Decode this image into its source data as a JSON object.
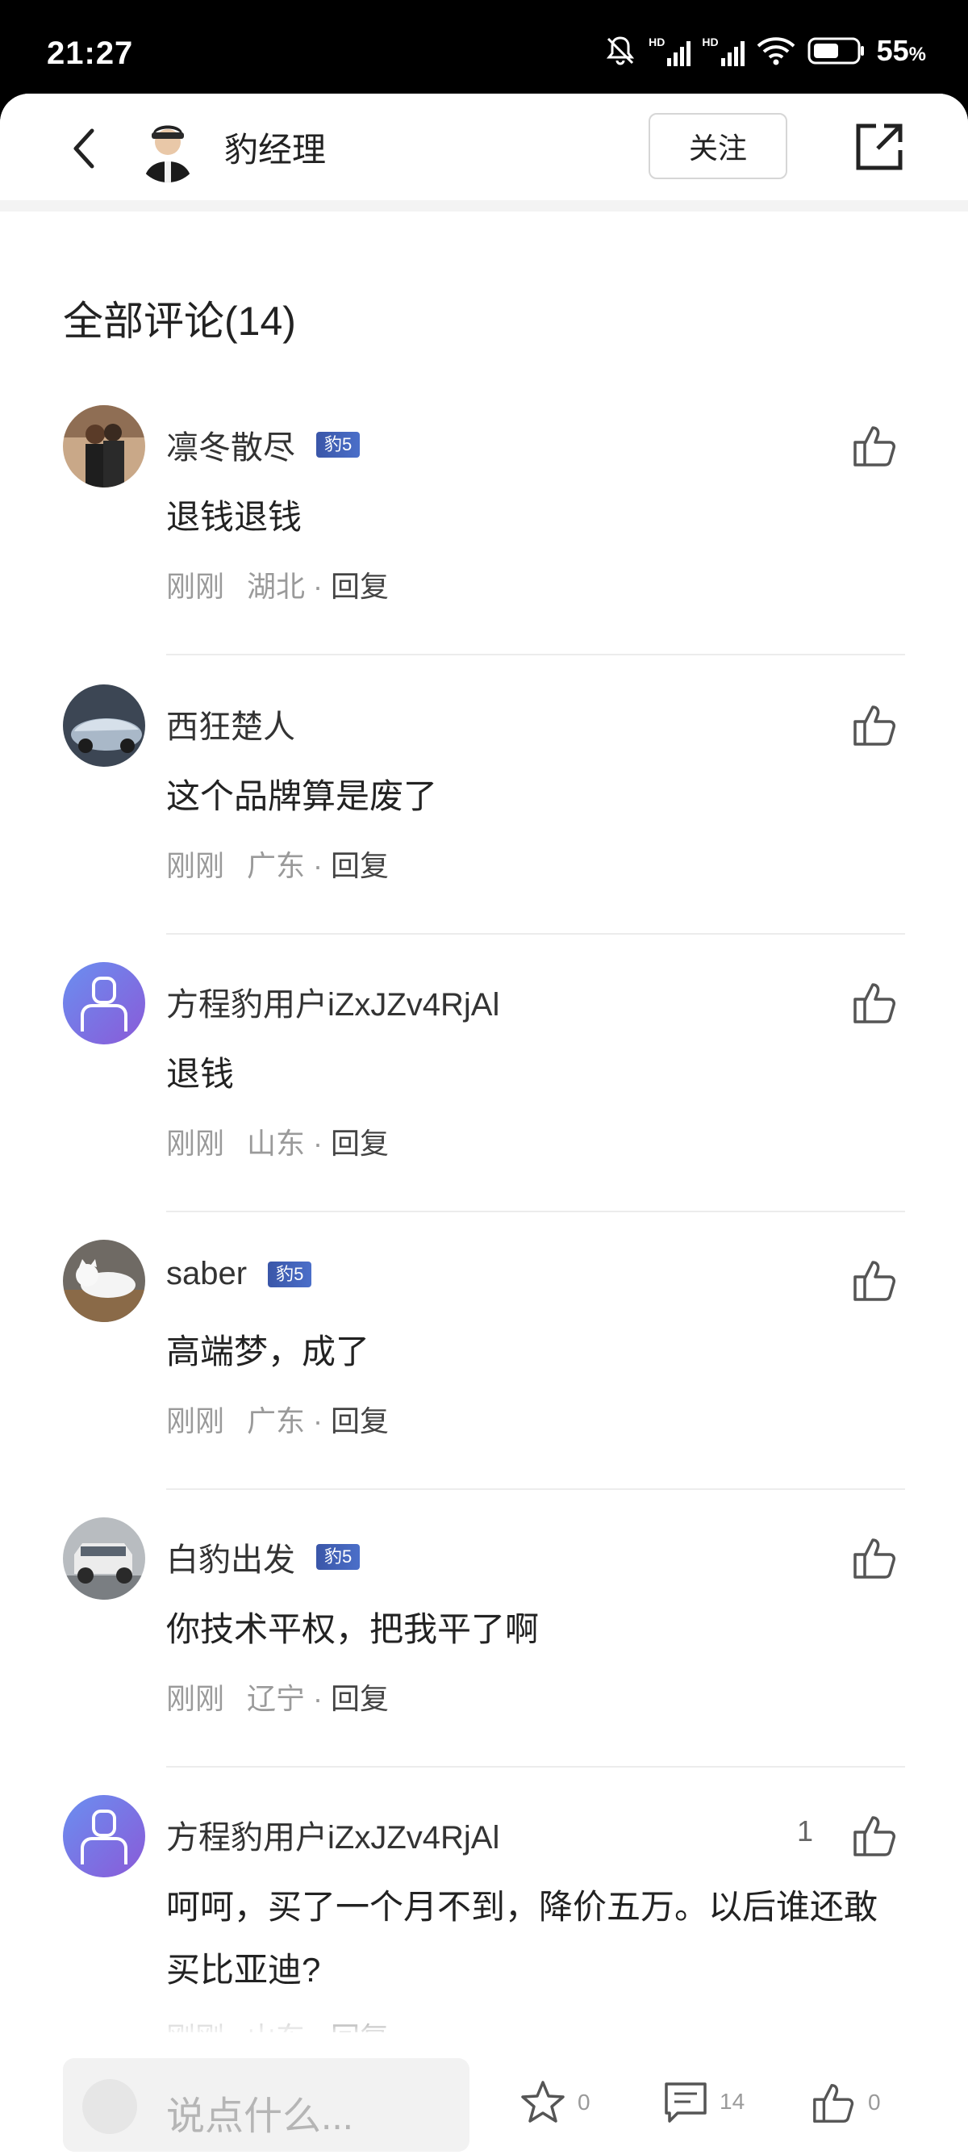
{
  "status_bar": {
    "time": "21:27",
    "battery": "55",
    "battery_unit": "%",
    "network1": "HD",
    "network2": "HD"
  },
  "header": {
    "author_name": "豹经理",
    "follow_label": "关注"
  },
  "comments_section": {
    "title": "全部评论(14)",
    "comments": [
      {
        "name": "凛冬散尽",
        "badge": "豹5",
        "text": "退钱退钱",
        "time": "刚刚",
        "location": "湖北",
        "reply_label": "回复"
      },
      {
        "name": "西狂楚人",
        "badge": "",
        "text": "这个品牌算是废了",
        "time": "刚刚",
        "location": "广东",
        "reply_label": "回复"
      },
      {
        "name": "方程豹用户iZxJZv4RjAl",
        "badge": "",
        "text": "退钱",
        "time": "刚刚",
        "location": "山东",
        "reply_label": "回复"
      },
      {
        "name": "saber",
        "badge": "豹5",
        "text": "高端梦，成了",
        "time": "刚刚",
        "location": "广东",
        "reply_label": "回复"
      },
      {
        "name": "白豹出发",
        "badge": "豹5",
        "text": "你技术平权，把我平了啊",
        "time": "刚刚",
        "location": "辽宁",
        "reply_label": "回复"
      },
      {
        "name": "方程豹用户iZxJZv4RjAl",
        "badge": "",
        "text": "呵呵，买了一个月不到，降价五万。以后谁还敢买比亚迪?",
        "time": "刚刚",
        "location": "山东",
        "reply_label": "回复",
        "likes": "1"
      }
    ]
  },
  "bottom_bar": {
    "placeholder": "说点什么...",
    "favorites_count": "0",
    "comments_count": "14",
    "likes_count": "0"
  }
}
